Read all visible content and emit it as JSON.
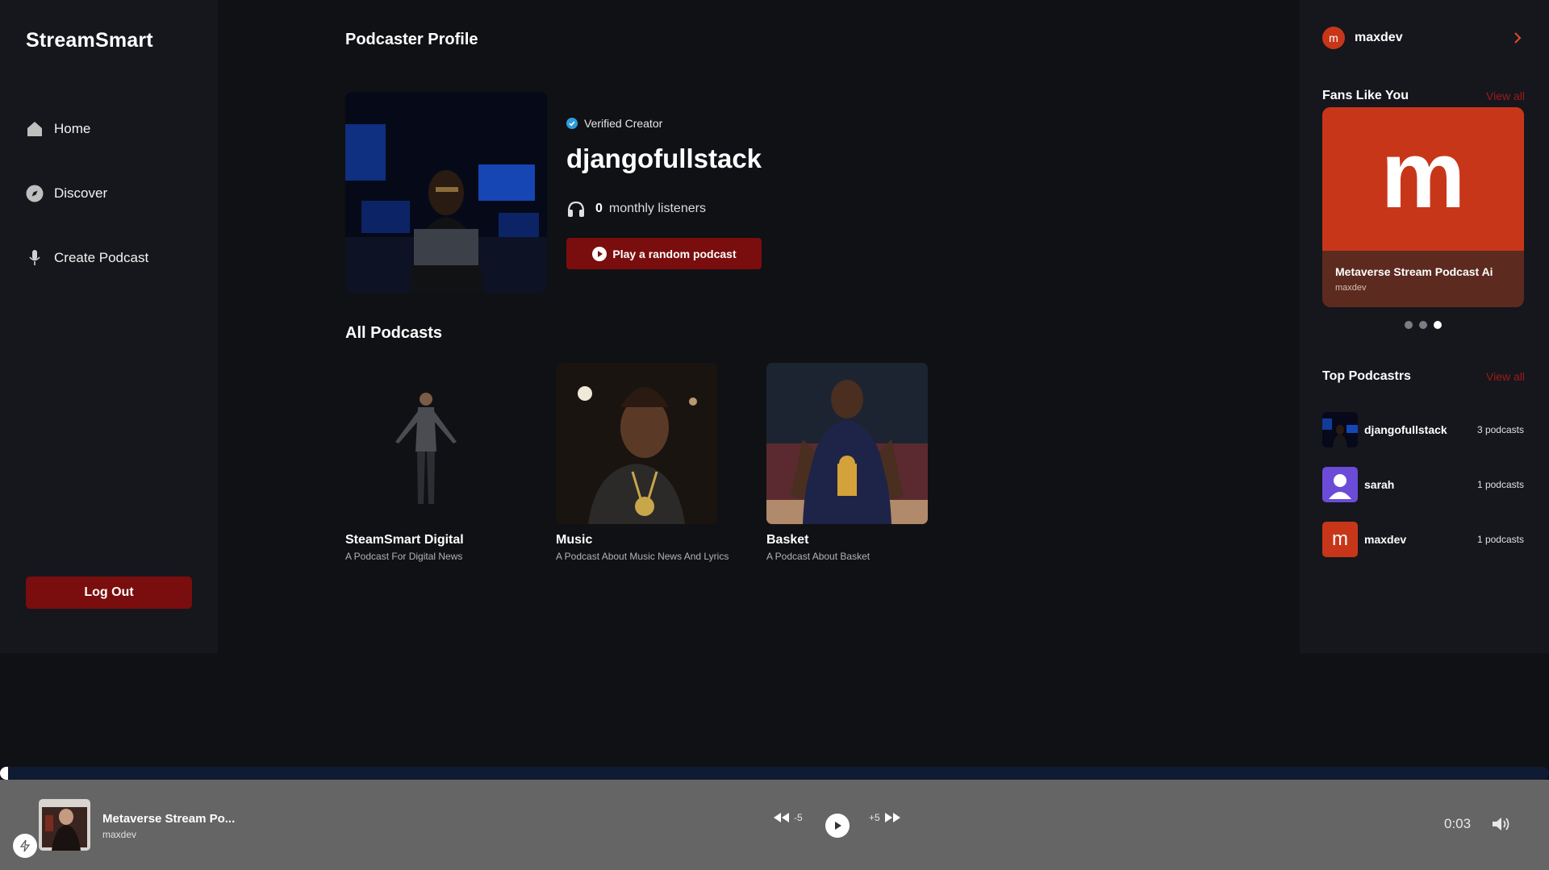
{
  "app": {
    "name": "StreamSmart"
  },
  "sidebar": {
    "items": [
      {
        "label": "Home",
        "icon": "home-icon"
      },
      {
        "label": "Discover",
        "icon": "compass-icon"
      },
      {
        "label": "Create Podcast",
        "icon": "microphone-icon"
      }
    ],
    "logout_label": "Log Out"
  },
  "main": {
    "title": "Podcaster Profile",
    "profile": {
      "verified_label": "Verified Creator",
      "name": "djangofullstack",
      "listeners_count": "0",
      "listeners_label": "monthly listeners",
      "play_random_label": "Play a random podcast"
    },
    "all_podcasts_title": "All Podcasts",
    "podcasts": [
      {
        "title": "SteamSmart Digital",
        "description": "A Podcast For Digital News"
      },
      {
        "title": "Music",
        "description": "A Podcast About Music News And Lyrics"
      },
      {
        "title": "Basket",
        "description": "A Podcast About Basket"
      }
    ]
  },
  "right": {
    "user": {
      "initial": "m",
      "name": "maxdev"
    },
    "fans_title": "Fans Like You",
    "fans_view_all": "View all",
    "fan_card": {
      "initial": "m",
      "title": "Metaverse Stream Podcast Ai",
      "author": "maxdev"
    },
    "carousel": {
      "count": 3,
      "active_index": 2
    },
    "top_title": "Top Podcastrs",
    "top_view_all": "View all",
    "top_podcasters": [
      {
        "name": "djangofullstack",
        "count": "3 podcasts"
      },
      {
        "name": "sarah",
        "count": "1 podcasts"
      },
      {
        "initial": "m",
        "name": "maxdev",
        "count": "1 podcasts"
      }
    ]
  },
  "player": {
    "title": "Metaverse Stream Po...",
    "author": "maxdev",
    "rewind_label": "-5",
    "forward_label": "+5",
    "time": "0:03",
    "progress": 0.002
  },
  "colors": {
    "accent": "#7a0d0d",
    "view_all": "#9e1a1a",
    "fan_orange": "#c8361a",
    "player_bg": "#656565",
    "verified_blue": "#2d9cdb"
  }
}
